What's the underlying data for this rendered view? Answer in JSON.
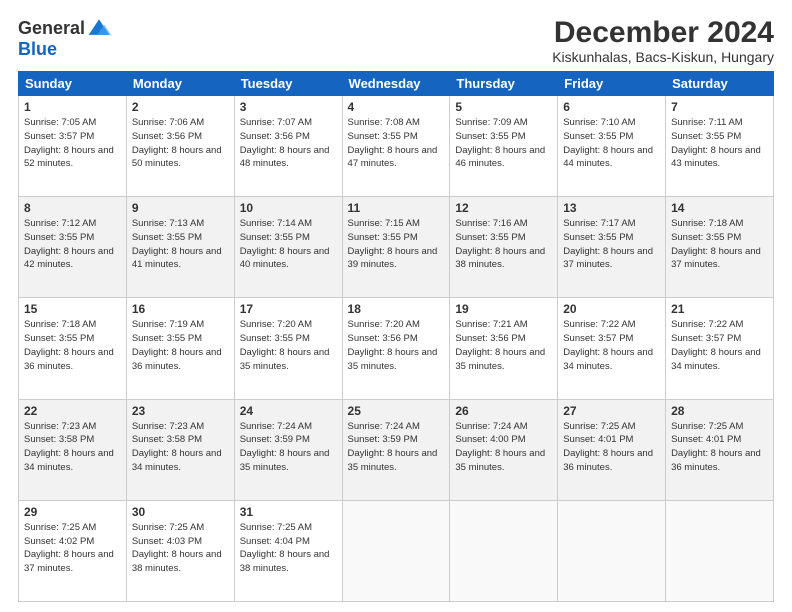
{
  "header": {
    "logo_general": "General",
    "logo_blue": "Blue",
    "title": "December 2024",
    "location": "Kiskunhalas, Bacs-Kiskun, Hungary"
  },
  "days_of_week": [
    "Sunday",
    "Monday",
    "Tuesday",
    "Wednesday",
    "Thursday",
    "Friday",
    "Saturday"
  ],
  "weeks": [
    [
      {
        "day": "1",
        "sunrise": "Sunrise: 7:05 AM",
        "sunset": "Sunset: 3:57 PM",
        "daylight": "Daylight: 8 hours and 52 minutes."
      },
      {
        "day": "2",
        "sunrise": "Sunrise: 7:06 AM",
        "sunset": "Sunset: 3:56 PM",
        "daylight": "Daylight: 8 hours and 50 minutes."
      },
      {
        "day": "3",
        "sunrise": "Sunrise: 7:07 AM",
        "sunset": "Sunset: 3:56 PM",
        "daylight": "Daylight: 8 hours and 48 minutes."
      },
      {
        "day": "4",
        "sunrise": "Sunrise: 7:08 AM",
        "sunset": "Sunset: 3:55 PM",
        "daylight": "Daylight: 8 hours and 47 minutes."
      },
      {
        "day": "5",
        "sunrise": "Sunrise: 7:09 AM",
        "sunset": "Sunset: 3:55 PM",
        "daylight": "Daylight: 8 hours and 46 minutes."
      },
      {
        "day": "6",
        "sunrise": "Sunrise: 7:10 AM",
        "sunset": "Sunset: 3:55 PM",
        "daylight": "Daylight: 8 hours and 44 minutes."
      },
      {
        "day": "7",
        "sunrise": "Sunrise: 7:11 AM",
        "sunset": "Sunset: 3:55 PM",
        "daylight": "Daylight: 8 hours and 43 minutes."
      }
    ],
    [
      {
        "day": "8",
        "sunrise": "Sunrise: 7:12 AM",
        "sunset": "Sunset: 3:55 PM",
        "daylight": "Daylight: 8 hours and 42 minutes."
      },
      {
        "day": "9",
        "sunrise": "Sunrise: 7:13 AM",
        "sunset": "Sunset: 3:55 PM",
        "daylight": "Daylight: 8 hours and 41 minutes."
      },
      {
        "day": "10",
        "sunrise": "Sunrise: 7:14 AM",
        "sunset": "Sunset: 3:55 PM",
        "daylight": "Daylight: 8 hours and 40 minutes."
      },
      {
        "day": "11",
        "sunrise": "Sunrise: 7:15 AM",
        "sunset": "Sunset: 3:55 PM",
        "daylight": "Daylight: 8 hours and 39 minutes."
      },
      {
        "day": "12",
        "sunrise": "Sunrise: 7:16 AM",
        "sunset": "Sunset: 3:55 PM",
        "daylight": "Daylight: 8 hours and 38 minutes."
      },
      {
        "day": "13",
        "sunrise": "Sunrise: 7:17 AM",
        "sunset": "Sunset: 3:55 PM",
        "daylight": "Daylight: 8 hours and 37 minutes."
      },
      {
        "day": "14",
        "sunrise": "Sunrise: 7:18 AM",
        "sunset": "Sunset: 3:55 PM",
        "daylight": "Daylight: 8 hours and 37 minutes."
      }
    ],
    [
      {
        "day": "15",
        "sunrise": "Sunrise: 7:18 AM",
        "sunset": "Sunset: 3:55 PM",
        "daylight": "Daylight: 8 hours and 36 minutes."
      },
      {
        "day": "16",
        "sunrise": "Sunrise: 7:19 AM",
        "sunset": "Sunset: 3:55 PM",
        "daylight": "Daylight: 8 hours and 36 minutes."
      },
      {
        "day": "17",
        "sunrise": "Sunrise: 7:20 AM",
        "sunset": "Sunset: 3:55 PM",
        "daylight": "Daylight: 8 hours and 35 minutes."
      },
      {
        "day": "18",
        "sunrise": "Sunrise: 7:20 AM",
        "sunset": "Sunset: 3:56 PM",
        "daylight": "Daylight: 8 hours and 35 minutes."
      },
      {
        "day": "19",
        "sunrise": "Sunrise: 7:21 AM",
        "sunset": "Sunset: 3:56 PM",
        "daylight": "Daylight: 8 hours and 35 minutes."
      },
      {
        "day": "20",
        "sunrise": "Sunrise: 7:22 AM",
        "sunset": "Sunset: 3:57 PM",
        "daylight": "Daylight: 8 hours and 34 minutes."
      },
      {
        "day": "21",
        "sunrise": "Sunrise: 7:22 AM",
        "sunset": "Sunset: 3:57 PM",
        "daylight": "Daylight: 8 hours and 34 minutes."
      }
    ],
    [
      {
        "day": "22",
        "sunrise": "Sunrise: 7:23 AM",
        "sunset": "Sunset: 3:58 PM",
        "daylight": "Daylight: 8 hours and 34 minutes."
      },
      {
        "day": "23",
        "sunrise": "Sunrise: 7:23 AM",
        "sunset": "Sunset: 3:58 PM",
        "daylight": "Daylight: 8 hours and 34 minutes."
      },
      {
        "day": "24",
        "sunrise": "Sunrise: 7:24 AM",
        "sunset": "Sunset: 3:59 PM",
        "daylight": "Daylight: 8 hours and 35 minutes."
      },
      {
        "day": "25",
        "sunrise": "Sunrise: 7:24 AM",
        "sunset": "Sunset: 3:59 PM",
        "daylight": "Daylight: 8 hours and 35 minutes."
      },
      {
        "day": "26",
        "sunrise": "Sunrise: 7:24 AM",
        "sunset": "Sunset: 4:00 PM",
        "daylight": "Daylight: 8 hours and 35 minutes."
      },
      {
        "day": "27",
        "sunrise": "Sunrise: 7:25 AM",
        "sunset": "Sunset: 4:01 PM",
        "daylight": "Daylight: 8 hours and 36 minutes."
      },
      {
        "day": "28",
        "sunrise": "Sunrise: 7:25 AM",
        "sunset": "Sunset: 4:01 PM",
        "daylight": "Daylight: 8 hours and 36 minutes."
      }
    ],
    [
      {
        "day": "29",
        "sunrise": "Sunrise: 7:25 AM",
        "sunset": "Sunset: 4:02 PM",
        "daylight": "Daylight: 8 hours and 37 minutes."
      },
      {
        "day": "30",
        "sunrise": "Sunrise: 7:25 AM",
        "sunset": "Sunset: 4:03 PM",
        "daylight": "Daylight: 8 hours and 38 minutes."
      },
      {
        "day": "31",
        "sunrise": "Sunrise: 7:25 AM",
        "sunset": "Sunset: 4:04 PM",
        "daylight": "Daylight: 8 hours and 38 minutes."
      },
      null,
      null,
      null,
      null
    ]
  ]
}
